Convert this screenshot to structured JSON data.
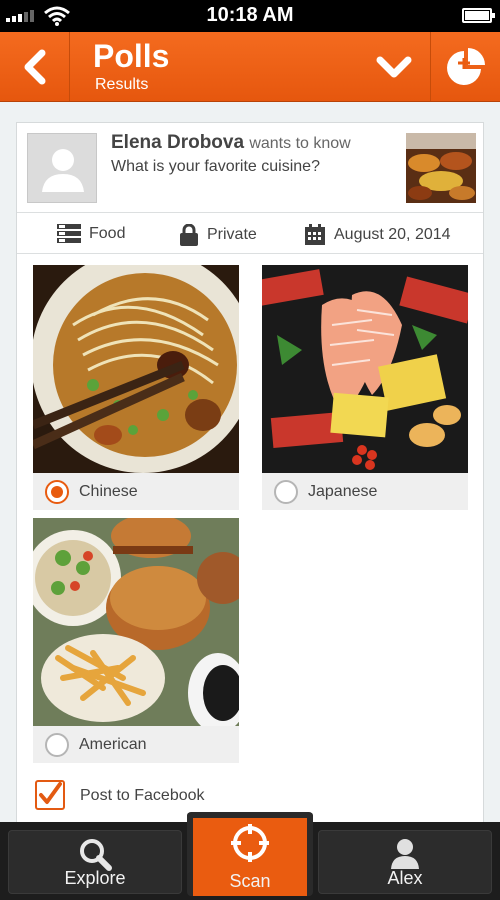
{
  "status_bar": {
    "time": "10:18 AM"
  },
  "header": {
    "title": "Polls",
    "subtitle": "Results"
  },
  "poll": {
    "author": "Elena Drobova",
    "verb": "wants to know",
    "question": "What is your favorite cuisine?",
    "category": "Food",
    "privacy": "Private",
    "date": "August 20, 2014",
    "options": [
      {
        "label": "Chinese",
        "selected": true
      },
      {
        "label": "Japanese",
        "selected": false
      },
      {
        "label": "American",
        "selected": false
      }
    ],
    "post_to_facebook": {
      "label": "Post to Facebook",
      "checked": true
    }
  },
  "tabs": [
    {
      "label": "Explore",
      "icon": "search-icon",
      "active": false
    },
    {
      "label": "Scan",
      "icon": "crosshair-icon",
      "active": true
    },
    {
      "label": "Alex",
      "icon": "person-icon",
      "active": false
    }
  ],
  "colors": {
    "accent": "#ea5c10",
    "tab_bar": "#1d1d1d"
  }
}
